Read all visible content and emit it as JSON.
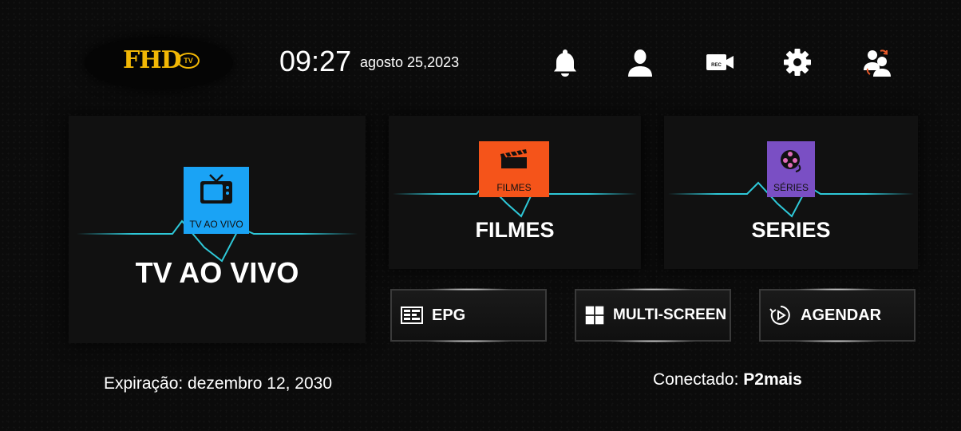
{
  "header": {
    "logo_text": "FHD",
    "logo_badge": "TV",
    "time": "09:27",
    "date": "agosto 25,2023",
    "icons": [
      "bell-icon",
      "user-icon",
      "rec-camera-icon",
      "gear-icon",
      "switch-user-icon"
    ],
    "rec_label": "REC"
  },
  "cards": {
    "live": {
      "badge": "TV AO VIVO",
      "label": "TV AO VIVO",
      "badge_color": "#1aa3f5"
    },
    "movies": {
      "badge": "FILMES",
      "label": "FILMES",
      "badge_color": "#f5541a"
    },
    "series": {
      "badge": "SÉRIES",
      "label": "SERIES",
      "badge_color": "#7a4fc4"
    }
  },
  "buttons": {
    "epg": "EPG",
    "multiscreen": "MULTI-SCREEN",
    "schedule": "AGENDAR"
  },
  "footer": {
    "expiration": "Expiração: dezembro 12, 2030",
    "connected_label": "Conectado:",
    "connected_value": "P2mais"
  },
  "colors": {
    "pulse": "#2ec8d8",
    "logo": "#f2b705"
  }
}
